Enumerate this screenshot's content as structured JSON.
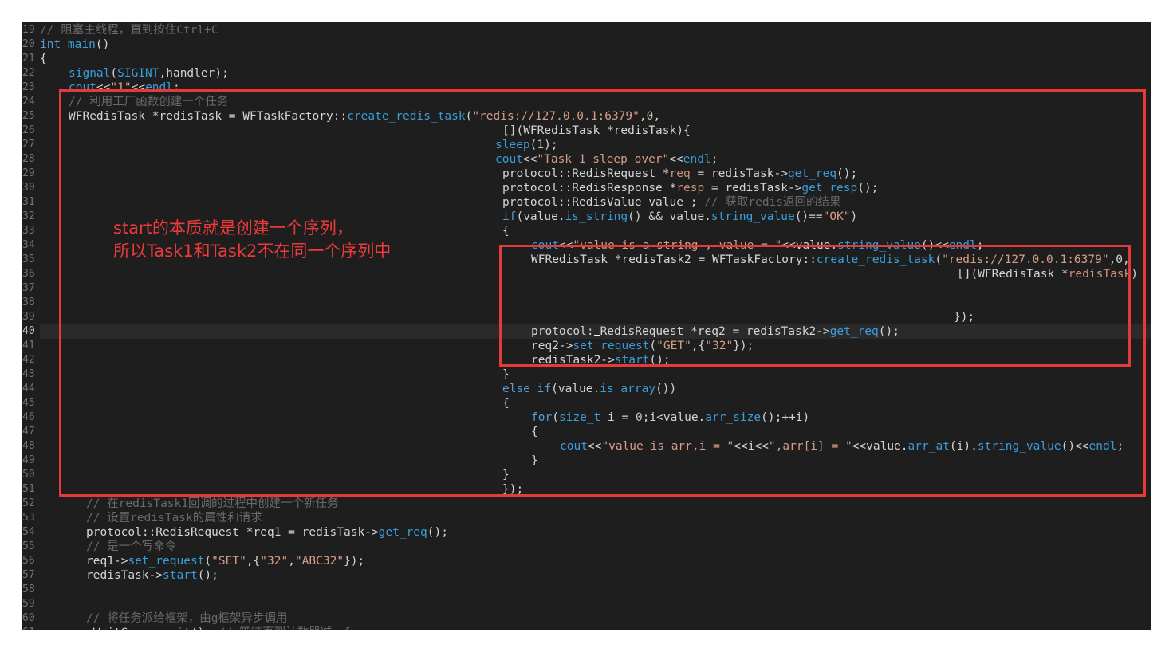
{
  "editor": {
    "active_line": "40",
    "lines": [
      {
        "no": "19",
        "indent": 0,
        "tokens": [
          {
            "t": "// 阻塞主线程，直到按住Ctrl+C",
            "c": "c"
          }
        ]
      },
      {
        "no": "20",
        "indent": 0,
        "tokens": [
          {
            "t": "int ",
            "c": "k"
          },
          {
            "t": "main",
            "c": "f"
          },
          {
            "t": "()",
            "c": "p"
          }
        ]
      },
      {
        "no": "21",
        "indent": 0,
        "tokens": [
          {
            "t": "{",
            "c": "p"
          }
        ]
      },
      {
        "no": "22",
        "indent": 36,
        "tokens": [
          {
            "t": "signal",
            "c": "f"
          },
          {
            "t": "(",
            "c": "p"
          },
          {
            "t": "SIGINT",
            "c": "f"
          },
          {
            "t": ",handler);",
            "c": "p"
          }
        ]
      },
      {
        "no": "23",
        "indent": 36,
        "tokens": [
          {
            "t": "cout",
            "c": "f"
          },
          {
            "t": "<<",
            "c": "p"
          },
          {
            "t": "\"1\"",
            "c": "s"
          },
          {
            "t": "<<",
            "c": "p"
          },
          {
            "t": "endl",
            "c": "f"
          },
          {
            "t": ";",
            "c": "p"
          }
        ]
      },
      {
        "no": "24",
        "indent": 36,
        "tokens": [
          {
            "t": "// 利用工厂函数创建一个任务",
            "c": "c"
          }
        ]
      },
      {
        "no": "25",
        "indent": 36,
        "tokens": [
          {
            "t": "WFRedisTask *redisTask = WFTaskFactory::",
            "c": "p"
          },
          {
            "t": "create_redis_task",
            "c": "f"
          },
          {
            "t": "(",
            "c": "p"
          },
          {
            "t": "\"redis://127.0.0.1:6379\"",
            "c": "s"
          },
          {
            "t": ",",
            "c": "p"
          },
          {
            "t": "0",
            "c": "n"
          },
          {
            "t": ",",
            "c": "p"
          }
        ]
      },
      {
        "no": "26",
        "indent": 580,
        "tokens": [
          {
            "t": "[](WFRedisTask *redisTask){",
            "c": "p"
          }
        ]
      },
      {
        "no": "27",
        "indent": 571,
        "tokens": [
          {
            "t": "sleep",
            "c": "f"
          },
          {
            "t": "(",
            "c": "p"
          },
          {
            "t": "1",
            "c": "n"
          },
          {
            "t": ");",
            "c": "p"
          }
        ]
      },
      {
        "no": "28",
        "indent": 571,
        "tokens": [
          {
            "t": "cout",
            "c": "f"
          },
          {
            "t": "<<",
            "c": "p"
          },
          {
            "t": "\"Task 1 sleep over\"",
            "c": "s"
          },
          {
            "t": "<<",
            "c": "p"
          },
          {
            "t": "endl",
            "c": "f"
          },
          {
            "t": ";",
            "c": "p"
          }
        ]
      },
      {
        "no": "29",
        "indent": 580,
        "tokens": [
          {
            "t": "protocol::RedisRequest *",
            "c": "p"
          },
          {
            "t": "req",
            "c": "y"
          },
          {
            "t": " = redisTask->",
            "c": "p"
          },
          {
            "t": "get_req",
            "c": "f"
          },
          {
            "t": "();",
            "c": "p"
          }
        ]
      },
      {
        "no": "30",
        "indent": 580,
        "tokens": [
          {
            "t": "protocol::RedisResponse *",
            "c": "p"
          },
          {
            "t": "resp",
            "c": "y"
          },
          {
            "t": " = redisTask->",
            "c": "p"
          },
          {
            "t": "get_resp",
            "c": "f"
          },
          {
            "t": "();",
            "c": "p"
          }
        ]
      },
      {
        "no": "31",
        "indent": 580,
        "tokens": [
          {
            "t": "protocol::RedisValue value ; ",
            "c": "p"
          },
          {
            "t": "// 获取redis返回的结果",
            "c": "c"
          }
        ]
      },
      {
        "no": "32",
        "indent": 580,
        "tokens": [
          {
            "t": "if",
            "c": "k"
          },
          {
            "t": "(value.",
            "c": "p"
          },
          {
            "t": "is_string",
            "c": "f"
          },
          {
            "t": "() && value.",
            "c": "p"
          },
          {
            "t": "string_value",
            "c": "f"
          },
          {
            "t": "()==",
            "c": "p"
          },
          {
            "t": "\"OK\"",
            "c": "s"
          },
          {
            "t": ")",
            "c": "p"
          }
        ]
      },
      {
        "no": "33",
        "indent": 580,
        "tokens": [
          {
            "t": "{",
            "c": "p"
          }
        ]
      },
      {
        "no": "34",
        "indent": 616,
        "tokens": [
          {
            "t": "cout",
            "c": "f"
          },
          {
            "t": "<<",
            "c": "p"
          },
          {
            "t": "\"value is a string , value = \"",
            "c": "s"
          },
          {
            "t": "<<value.",
            "c": "p"
          },
          {
            "t": "string_value",
            "c": "f"
          },
          {
            "t": "()<<",
            "c": "p"
          },
          {
            "t": "endl",
            "c": "f"
          },
          {
            "t": ";",
            "c": "p"
          }
        ]
      },
      {
        "no": "35",
        "indent": 616,
        "tokens": [
          {
            "t": "WFRedisTask *redisTask2 = WFTaskFactory::",
            "c": "p"
          },
          {
            "t": "create_redis_task",
            "c": "f"
          },
          {
            "t": "(",
            "c": "p"
          },
          {
            "t": "\"redis://127.0.0.1:6379\"",
            "c": "s"
          },
          {
            "t": ",0,",
            "c": "p"
          }
        ]
      },
      {
        "no": "36",
        "indent": 1150,
        "tokens": [
          {
            "t": "[](WFRedisTask *",
            "c": "p"
          },
          {
            "t": "redisTask",
            "c": "y"
          },
          {
            "t": ")",
            "c": "p"
          }
        ]
      },
      {
        "no": "37",
        "indent": 0,
        "tokens": []
      },
      {
        "no": "38",
        "indent": 0,
        "tokens": []
      },
      {
        "no": "39",
        "indent": 1146,
        "tokens": [
          {
            "t": "});",
            "c": "p"
          }
        ]
      },
      {
        "no": "40",
        "indent": 616,
        "tokens": [
          {
            "t": "protocol:",
            "c": "p"
          },
          {
            "t": "CARET",
            "c": "caret"
          },
          {
            "t": "RedisRequest *req2 = redisTask2->",
            "c": "p"
          },
          {
            "t": "get_req",
            "c": "f"
          },
          {
            "t": "();",
            "c": "p"
          }
        ]
      },
      {
        "no": "41",
        "indent": 616,
        "tokens": [
          {
            "t": "req2->",
            "c": "p"
          },
          {
            "t": "set_request",
            "c": "f"
          },
          {
            "t": "(",
            "c": "p"
          },
          {
            "t": "\"GET\"",
            "c": "s"
          },
          {
            "t": ",{",
            "c": "p"
          },
          {
            "t": "\"32\"",
            "c": "s"
          },
          {
            "t": "});",
            "c": "p"
          }
        ]
      },
      {
        "no": "42",
        "indent": 616,
        "tokens": [
          {
            "t": "redisTask2->",
            "c": "p"
          },
          {
            "t": "start",
            "c": "f"
          },
          {
            "t": "();",
            "c": "p"
          }
        ]
      },
      {
        "no": "43",
        "indent": 580,
        "tokens": [
          {
            "t": "}",
            "c": "p"
          }
        ]
      },
      {
        "no": "44",
        "indent": 580,
        "tokens": [
          {
            "t": "else if",
            "c": "k"
          },
          {
            "t": "(value.",
            "c": "p"
          },
          {
            "t": "is_array",
            "c": "f"
          },
          {
            "t": "())",
            "c": "p"
          }
        ]
      },
      {
        "no": "45",
        "indent": 580,
        "tokens": [
          {
            "t": "{",
            "c": "p"
          }
        ]
      },
      {
        "no": "46",
        "indent": 616,
        "tokens": [
          {
            "t": "for",
            "c": "k"
          },
          {
            "t": "(",
            "c": "p"
          },
          {
            "t": "size_t",
            "c": "f"
          },
          {
            "t": " i = ",
            "c": "p"
          },
          {
            "t": "0",
            "c": "n"
          },
          {
            "t": ";i<value.",
            "c": "p"
          },
          {
            "t": "arr_size",
            "c": "f"
          },
          {
            "t": "();++i)",
            "c": "p"
          }
        ]
      },
      {
        "no": "47",
        "indent": 616,
        "tokens": [
          {
            "t": "{",
            "c": "p"
          }
        ]
      },
      {
        "no": "48",
        "indent": 652,
        "tokens": [
          {
            "t": "cout",
            "c": "f"
          },
          {
            "t": "<<",
            "c": "p"
          },
          {
            "t": "\"value is arr,i = \"",
            "c": "s"
          },
          {
            "t": "<<i<<",
            "c": "p"
          },
          {
            "t": "\",arr[i] = \"",
            "c": "s"
          },
          {
            "t": "<<value.",
            "c": "p"
          },
          {
            "t": "arr_at",
            "c": "f"
          },
          {
            "t": "(i).",
            "c": "p"
          },
          {
            "t": "string_value",
            "c": "f"
          },
          {
            "t": "()<<",
            "c": "p"
          },
          {
            "t": "endl",
            "c": "f"
          },
          {
            "t": ";",
            "c": "p"
          }
        ]
      },
      {
        "no": "49",
        "indent": 616,
        "tokens": [
          {
            "t": "}",
            "c": "p"
          }
        ]
      },
      {
        "no": "50",
        "indent": 580,
        "tokens": [
          {
            "t": "}",
            "c": "p"
          }
        ]
      },
      {
        "no": "51",
        "indent": 580,
        "tokens": [
          {
            "t": "});",
            "c": "p"
          }
        ]
      },
      {
        "no": "52",
        "indent": 58,
        "tokens": [
          {
            "t": "// 在redisTask1回调的过程中创建一个新任务",
            "c": "c"
          }
        ]
      },
      {
        "no": "53",
        "indent": 58,
        "tokens": [
          {
            "t": "// 设置redisTask的属性和请求",
            "c": "c"
          }
        ]
      },
      {
        "no": "54",
        "indent": 58,
        "tokens": [
          {
            "t": "protocol::RedisRequest *req1 = redisTask->",
            "c": "p"
          },
          {
            "t": "get_req",
            "c": "f"
          },
          {
            "t": "();",
            "c": "p"
          }
        ]
      },
      {
        "no": "55",
        "indent": 58,
        "tokens": [
          {
            "t": "// 是一个写命令",
            "c": "c"
          }
        ]
      },
      {
        "no": "56",
        "indent": 58,
        "tokens": [
          {
            "t": "req1->",
            "c": "p"
          },
          {
            "t": "set_request",
            "c": "f"
          },
          {
            "t": "(",
            "c": "p"
          },
          {
            "t": "\"SET\"",
            "c": "s"
          },
          {
            "t": ",{",
            "c": "p"
          },
          {
            "t": "\"32\"",
            "c": "s"
          },
          {
            "t": ",",
            "c": "p"
          },
          {
            "t": "\"ABC32\"",
            "c": "s"
          },
          {
            "t": "});",
            "c": "p"
          }
        ]
      },
      {
        "no": "57",
        "indent": 58,
        "tokens": [
          {
            "t": "redisTask->",
            "c": "p"
          },
          {
            "t": "start",
            "c": "f"
          },
          {
            "t": "();",
            "c": "p"
          }
        ]
      },
      {
        "no": "58",
        "indent": 0,
        "tokens": []
      },
      {
        "no": "59",
        "indent": 0,
        "tokens": []
      },
      {
        "no": "60",
        "indent": 58,
        "tokens": [
          {
            "t": "// 将任务派给框架，由g框架异步调用",
            "c": "c"
          }
        ]
      },
      {
        "no": "61",
        "indent": 58,
        "tokens": [
          {
            "t": "gWaitGroup.",
            "c": "p"
          },
          {
            "t": "wait",
            "c": "f"
          },
          {
            "t": "(); ",
            "c": "p"
          },
          {
            "t": "// 等待直到计数器减一f",
            "c": "c"
          }
        ]
      }
    ]
  },
  "annotation": {
    "text": "start的本质就是创建一个序列，\n所以Task1和Task2不在同一个序列中",
    "color": "#e53a3a"
  },
  "colors": {
    "background": "#1e1e1e",
    "keyword": "#569cd6",
    "function": "#3a9ddb",
    "string": "#d69d85",
    "comment": "#6a6a6a",
    "highlight_box": "#e53a3a"
  }
}
